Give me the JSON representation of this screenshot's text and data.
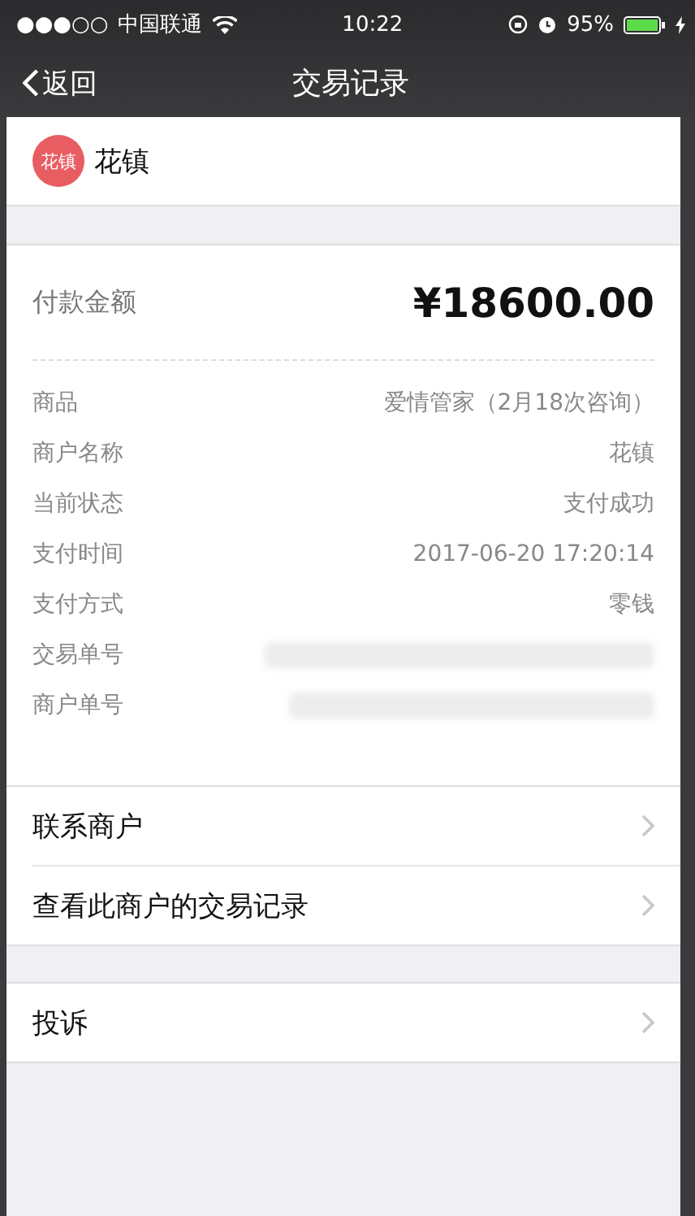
{
  "status_bar": {
    "signal": "●●●○○",
    "carrier": "中国联通",
    "time": "10:22",
    "battery": "95%"
  },
  "nav_bar": {
    "back": "返回",
    "title": "交易记录"
  },
  "merchant": {
    "logo": "花镇",
    "name": "花镇"
  },
  "amount": {
    "label": "付款金额",
    "value": "¥18600.00"
  },
  "details": [
    {
      "label": "商品",
      "value": "爱情管家（2月18次咨询）",
      "kind": "text"
    },
    {
      "label": "商户名称",
      "value": "花镇",
      "kind": "text"
    },
    {
      "label": "当前状态",
      "value": "支付成功",
      "kind": "text"
    },
    {
      "label": "支付时间",
      "value": "2017-06-20 17:20:14",
      "kind": "text"
    },
    {
      "label": "支付方式",
      "value": "零钱",
      "kind": "text"
    },
    {
      "label": "交易单号",
      "kind": "redacted"
    },
    {
      "label": "商户单号",
      "kind": "redacted"
    }
  ],
  "menu_groups": [
    [
      {
        "label": "联系商户"
      },
      {
        "label": "查看此商户的交易记录"
      }
    ],
    [
      {
        "label": "投诉"
      }
    ]
  ]
}
